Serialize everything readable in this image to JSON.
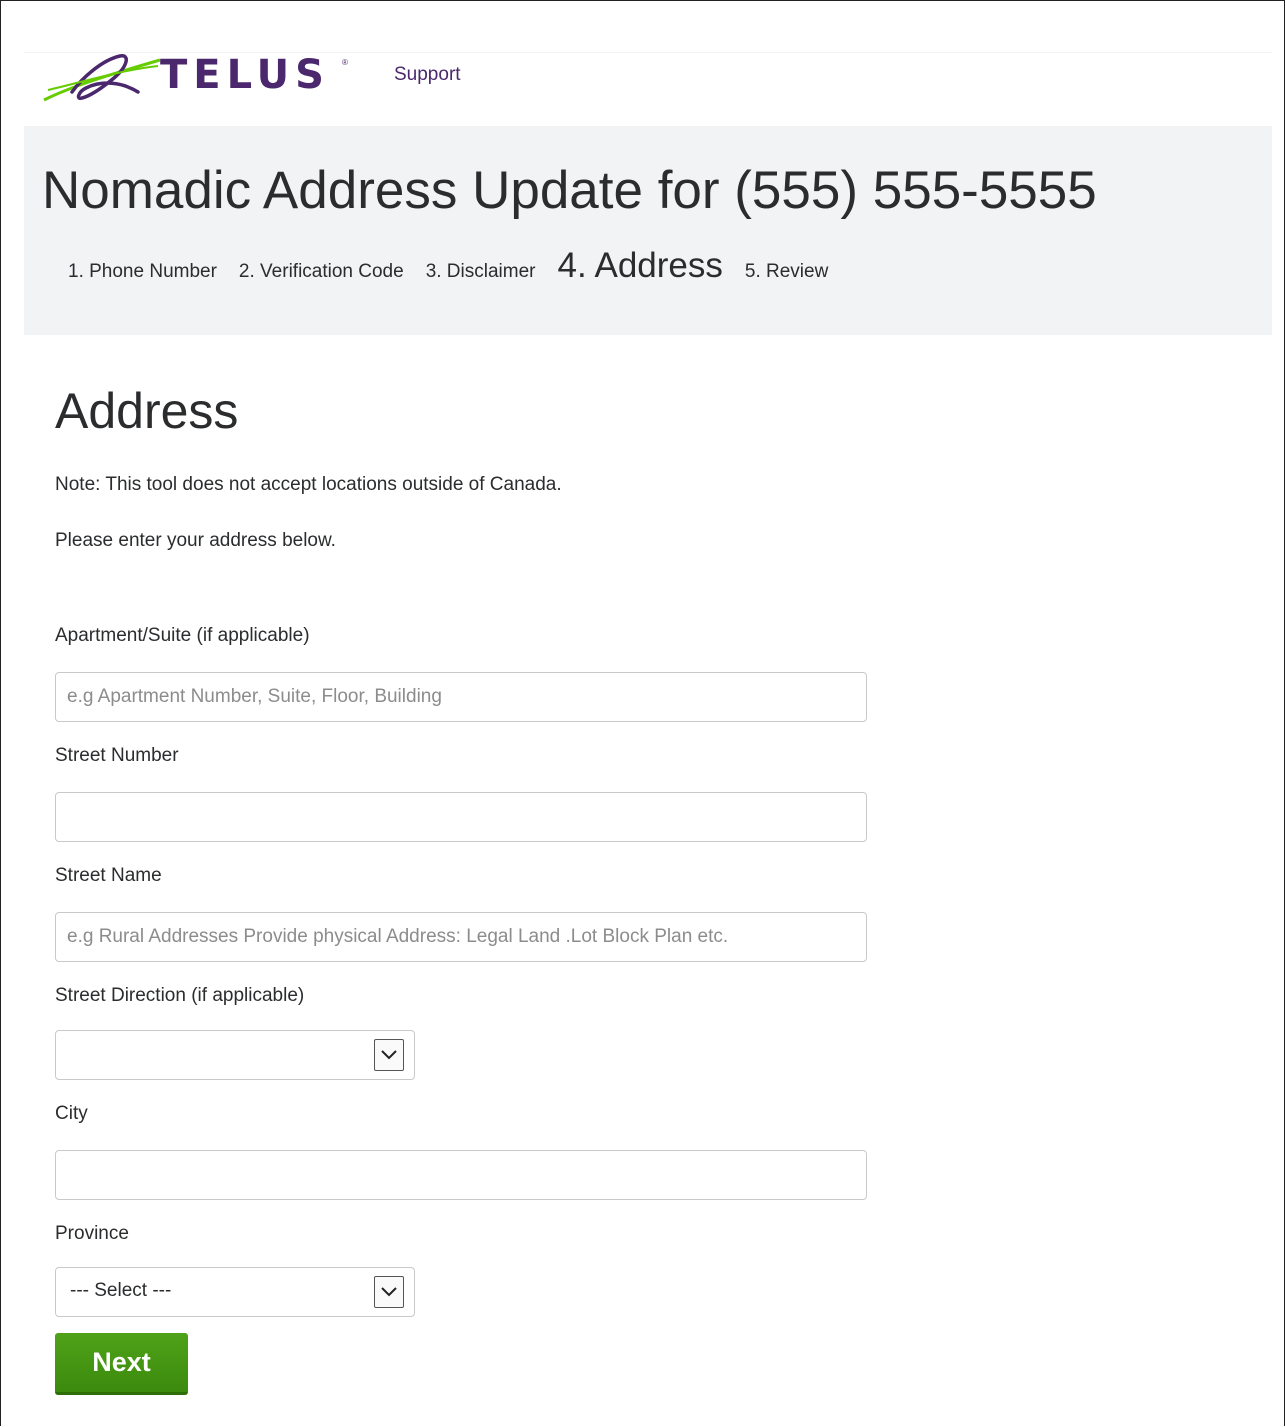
{
  "header": {
    "brand": "TELUS",
    "support_link": "Support"
  },
  "banner": {
    "title": "Nomadic Address Update for (555) 555-5555",
    "steps": [
      {
        "label": "1. Phone Number",
        "active": false
      },
      {
        "label": "2. Verification Code",
        "active": false
      },
      {
        "label": "3. Disclaimer",
        "active": false
      },
      {
        "label": "4. Address",
        "active": true
      },
      {
        "label": "5. Review",
        "active": false
      }
    ]
  },
  "form": {
    "section_title": "Address",
    "note": "Note: This tool does not accept locations outside of Canada.",
    "intro": "Please enter your address below.",
    "apartment": {
      "label": "Apartment/Suite (if applicable)",
      "placeholder": "e.g Apartment Number, Suite, Floor, Building",
      "value": ""
    },
    "street_number": {
      "label": "Street Number",
      "placeholder": "",
      "value": ""
    },
    "street_name": {
      "label": "Street Name",
      "placeholder": "e.g Rural Addresses Provide physical Address: Legal Land .Lot Block Plan etc.",
      "value": ""
    },
    "street_direction": {
      "label": "Street Direction (if applicable)",
      "selected": ""
    },
    "city": {
      "label": "City",
      "placeholder": "",
      "value": ""
    },
    "province": {
      "label": "Province",
      "selected": "--- Select ---"
    },
    "next_label": "Next"
  },
  "colors": {
    "brand_purple": "#4b286d",
    "brand_green": "#66cc00",
    "button_green": "#4fa218",
    "banner_bg": "#f2f3f5"
  }
}
